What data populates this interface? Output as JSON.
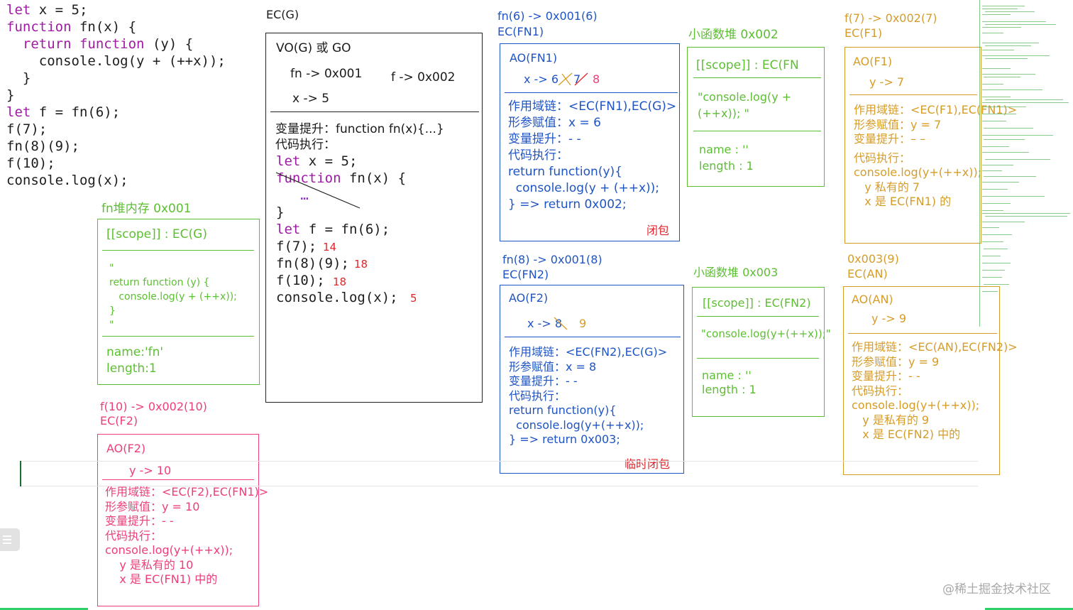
{
  "code_left": [
    {
      "parts": [
        [
          "kw",
          "let"
        ],
        [
          "nm",
          " x = "
        ],
        [
          "num",
          "5"
        ],
        [
          "nm",
          ";"
        ]
      ]
    },
    {
      "parts": [
        [
          "kw",
          "function"
        ],
        [
          "nm",
          " fn(x) {"
        ]
      ]
    },
    {
      "parts": [
        [
          "nm",
          "  "
        ],
        [
          "kw",
          "return"
        ],
        [
          "nm",
          " "
        ],
        [
          "kw",
          "function"
        ],
        [
          "nm",
          " (y) {"
        ]
      ]
    },
    {
      "parts": [
        [
          "nm",
          "    console.log(y + (++x));"
        ]
      ]
    },
    {
      "parts": [
        [
          "nm",
          "  }"
        ]
      ]
    },
    {
      "parts": [
        [
          "nm",
          "}"
        ]
      ]
    },
    {
      "parts": [
        [
          "kw",
          "let"
        ],
        [
          "nm",
          " f = fn(6);"
        ]
      ]
    },
    {
      "parts": [
        [
          "nm",
          "f(7);"
        ]
      ]
    },
    {
      "parts": [
        [
          "nm",
          "fn(8)(9);"
        ]
      ]
    },
    {
      "parts": [
        [
          "nm",
          "f(10);"
        ]
      ]
    },
    {
      "parts": [
        [
          "nm",
          "console.log(x);"
        ]
      ]
    }
  ],
  "ecg": {
    "label": "EC(G)",
    "vo": "VO(G) 或 GO",
    "fn_addr": "fn -> 0x001",
    "f_addr": "f -> 0x002",
    "x_val": "x -> 5",
    "hoist": "变量提升：function fn(x){...}",
    "exec": "代码执行：",
    "code": [
      {
        "parts": [
          [
            "kw",
            "let"
          ],
          [
            "nm",
            " x = 5;"
          ]
        ]
      },
      {
        "parts": [
          [
            "kw",
            "function"
          ],
          [
            "nm",
            " fn(x) {"
          ]
        ]
      },
      {
        "parts": [
          [
            "purple",
            "   …"
          ]
        ]
      },
      {
        "parts": [
          [
            "nm",
            "}"
          ]
        ]
      },
      {
        "parts": [
          [
            "kw",
            "let"
          ],
          [
            "nm",
            " f = fn(6);"
          ]
        ]
      },
      {
        "parts": [
          [
            "nm",
            "f(7);"
          ]
        ]
      },
      {
        "parts": [
          [
            "nm",
            "fn(8)(9);"
          ]
        ]
      },
      {
        "parts": [
          [
            "nm",
            "f(10);"
          ]
        ]
      },
      {
        "parts": [
          [
            "nm",
            "console.log(x);"
          ]
        ]
      }
    ],
    "results": [
      "14",
      "18",
      "18",
      "5"
    ]
  },
  "fn_heap": {
    "title": "fn堆内存   0x001",
    "scope": "[[scope]] : EC(G)",
    "body": [
      "\"",
      "return function (y) {",
      "   console.log(y + (++x));",
      "}",
      "\""
    ],
    "name": "name:'fn'",
    "length": "length:1"
  },
  "f10": {
    "title1": "f(10) -> 0x002(10)",
    "title2": "EC(F2)",
    "ao": "AO(F2)",
    "y": "y -> 10",
    "lines": [
      "作用域链：<EC(F2),EC(FN1)>",
      "形参赋值：y = 10",
      "变量提升：- -",
      "代码执行：",
      "console.log(y+(++x));",
      "    y 是私有的 10",
      "    x 是 EC(FN1) 中的"
    ]
  },
  "fn6": {
    "title1": "fn(6) -> 0x001(6)",
    "title2": "EC(FN1)",
    "ao": "AO(FN1)",
    "x": "x -> 6",
    "x_struck": "7",
    "x_new": "8",
    "lines": [
      "作用域链：<EC(FN1),EC(G)>",
      "形参赋值：x = 6",
      "变量提升：- -",
      "代码执行：",
      "return function(y){",
      "  console.log(y + (++x));",
      "} => return 0x002;"
    ],
    "note": "闭包"
  },
  "heap2": {
    "title": "小函数堆 0x002",
    "scope": "[[scope]] : EC(FN",
    "body1": "\"console.log(y +",
    "body2": "(++x)); \"",
    "name": "name : ''",
    "length": "length : 1"
  },
  "f7": {
    "title1": "f(7) -> 0x002(7)",
    "title2": "EC(F1)",
    "ao": "AO(F1)",
    "y": "y -> 7",
    "lines": [
      "作用域链：<EC(F1),EC(FN1)>",
      "形参赋值：y = 7",
      "变量提升：– –",
      "代码执行：",
      "console.log(y+(++x));",
      "   y 私有的 7",
      "   x 是 EC(FN1) 的"
    ]
  },
  "fn8": {
    "title1": "fn(8) -> 0x001(8)",
    "title2": "EC(FN2)",
    "ao": "AO(F2)",
    "x": "x -> 8",
    "x_new": "9",
    "lines": [
      "作用域链：<EC(FN2),EC(G)>",
      "形参赋值：x = 8",
      "变量提升：- -",
      "代码执行：",
      "return function(y){",
      "  console.log(y+(++x));",
      "} => return 0x003;"
    ],
    "note": "临时闭包"
  },
  "heap3": {
    "title": "小函数堆 0x003",
    "scope": "[[scope]] : EC(FN2)",
    "body": "\"console.log(y+(++x));\"",
    "name": "name : ''",
    "length": "length : 1"
  },
  "an": {
    "title1": "0x003(9)",
    "title2": "EC(AN)",
    "ao": "AO(AN)",
    "y": "y -> 9",
    "lines": [
      "作用域链：<EC(AN),EC(FN2)>",
      "形参赋值：y = 9",
      "变量提升：- -",
      "代码执行：",
      "console.log(y+(++x));",
      "   y 是私有的 9",
      "   x 是 EC(FN2) 中的"
    ]
  },
  "watermark": "@稀土掘金技术社区",
  "colors": {
    "green": "#5cbf32",
    "blue": "#1f54c4",
    "orange": "#d69c28",
    "pink": "#ec3e7a",
    "red": "#e0262b"
  }
}
